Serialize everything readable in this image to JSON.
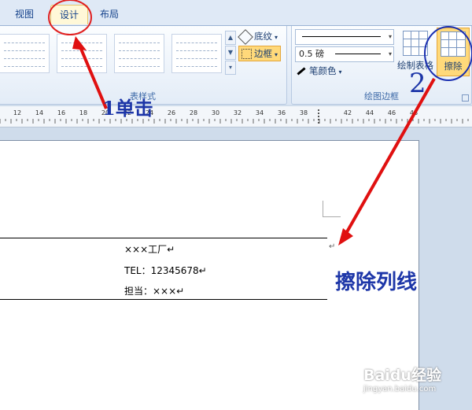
{
  "tabs": [
    {
      "label": "视图"
    },
    {
      "label": "设计"
    },
    {
      "label": "布局"
    }
  ],
  "ribbon": {
    "table_styles_label": "表样式",
    "shading_label": "底纹",
    "border_label": "边框",
    "draw_borders_label": "绘图边框",
    "line_weight": "0.5 磅",
    "pen_color_label": "笔颜色",
    "draw_table_label": "绘制表格",
    "erase_label": "擦除"
  },
  "ruler": {
    "ticks": [
      "12",
      "14",
      "16",
      "18",
      "20",
      "22",
      "24",
      "26",
      "28",
      "30",
      "32",
      "34",
      "36",
      "38",
      "42",
      "44",
      "46",
      "48"
    ]
  },
  "document": {
    "line1": "×××工厂↵",
    "line2": "TEL：12345678↵",
    "line3": "担当：×××↵",
    "para_mark": "↵"
  },
  "annotations": {
    "step1": "1单击",
    "step2": "2",
    "erase_caption": "擦除列线",
    "circle_color": "#e02020",
    "erase_circle_color": "#1a2fb0",
    "arrow_color": "#e01010"
  },
  "watermark": {
    "brand": "Baidu经验",
    "url": "jingyan.baidu.com"
  }
}
